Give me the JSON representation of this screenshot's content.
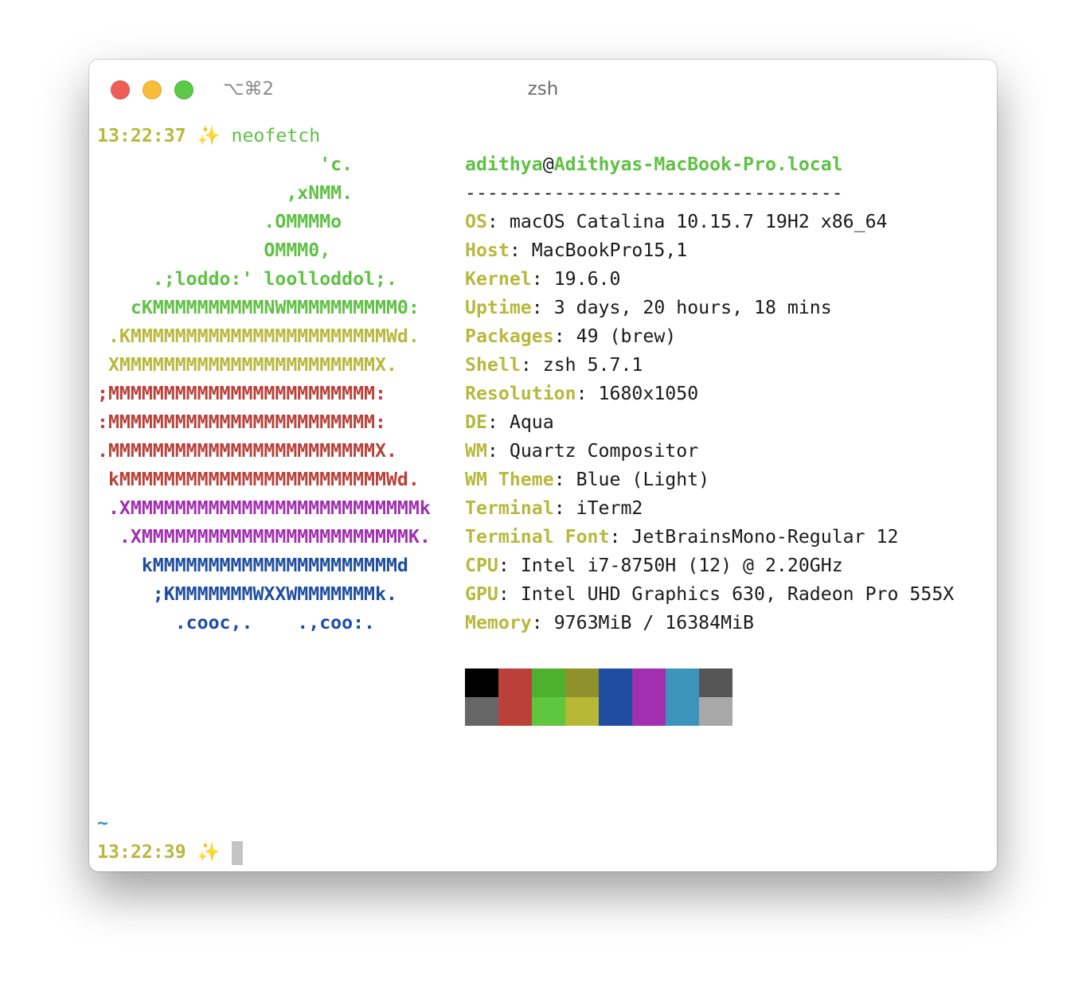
{
  "window": {
    "title": "zsh",
    "shortcut": "⌥⌘2"
  },
  "prompt": {
    "time": "13:22:37",
    "icon": "sparkles-icon",
    "command": "neofetch"
  },
  "logo": {
    "colors": {
      "green": "#5fc144",
      "yellow": "#b7b93e",
      "red": "#b9413a",
      "magenta": "#a22fb0",
      "blue": "#1f4ea0"
    },
    "lines": [
      "                    'c.",
      "                 ,xNMM.",
      "               .OMMMMo",
      "               OMMM0,",
      "     .;loddo:' loolloddol;.",
      "   cKMMMMMMMMMMNWMMMMMMMMMM0:",
      " .KMMMMMMMMMMMMMMMMMMMMMMMWd.",
      " XMMMMMMMMMMMMMMMMMMMMMMMX.",
      ";MMMMMMMMMMMMMMMMMMMMMMMM:",
      ":MMMMMMMMMMMMMMMMMMMMMMMM:",
      ".MMMMMMMMMMMMMMMMMMMMMMMMX.",
      " kMMMMMMMMMMMMMMMMMMMMMMMMWd.",
      " .XMMMMMMMMMMMMMMMMMMMMMMMMMMk",
      "  .XMMMMMMMMMMMMMMMMMMMMMMMMK.",
      "    kMMMMMMMMMMMMMMMMMMMMMMd",
      "     ;KMMMMMMMWXXWMMMMMMMk.",
      "       .cooc,.    .,coo:."
    ]
  },
  "info": {
    "user": "adithya",
    "at": "@",
    "host": "Adithyas-MacBook-Pro.local",
    "separator": "----------------------------------",
    "colon": ":",
    "rows": [
      {
        "label": "OS",
        "value": "macOS Catalina 10.15.7 19H2 x86_64"
      },
      {
        "label": "Host",
        "value": "MacBookPro15,1"
      },
      {
        "label": "Kernel",
        "value": "19.6.0"
      },
      {
        "label": "Uptime",
        "value": "3 days, 20 hours, 18 mins"
      },
      {
        "label": "Packages",
        "value": "49 (brew)"
      },
      {
        "label": "Shell",
        "value": "zsh 5.7.1"
      },
      {
        "label": "Resolution",
        "value": "1680x1050"
      },
      {
        "label": "DE",
        "value": "Aqua"
      },
      {
        "label": "WM",
        "value": "Quartz Compositor"
      },
      {
        "label": "WM Theme",
        "value": "Blue (Light)"
      },
      {
        "label": "Terminal",
        "value": "iTerm2"
      },
      {
        "label": "Terminal Font",
        "value": "JetBrainsMono-Regular 12"
      },
      {
        "label": "CPU",
        "value": "Intel i7-8750H (12) @ 2.20GHz"
      },
      {
        "label": "GPU",
        "value": "Intel UHD Graphics 630, Radeon Pro 555X"
      },
      {
        "label": "Memory",
        "value": "9763MiB / 16384MiB"
      }
    ]
  },
  "palette": {
    "normal": [
      "#000000",
      "#b9413a",
      "#4db02f",
      "#8f912b",
      "#1f4ea0",
      "#a22fb0",
      "#3d94bb",
      "#565656"
    ],
    "bright": [
      "#666666",
      "#b9413a",
      "#5fc63e",
      "#b6b836",
      "#1f4ea0",
      "#a22fb0",
      "#3d94bb",
      "#a8a8a8"
    ]
  },
  "cwd": "~",
  "prompt2": {
    "time": "13:22:39",
    "icon": "sparkles-icon"
  }
}
